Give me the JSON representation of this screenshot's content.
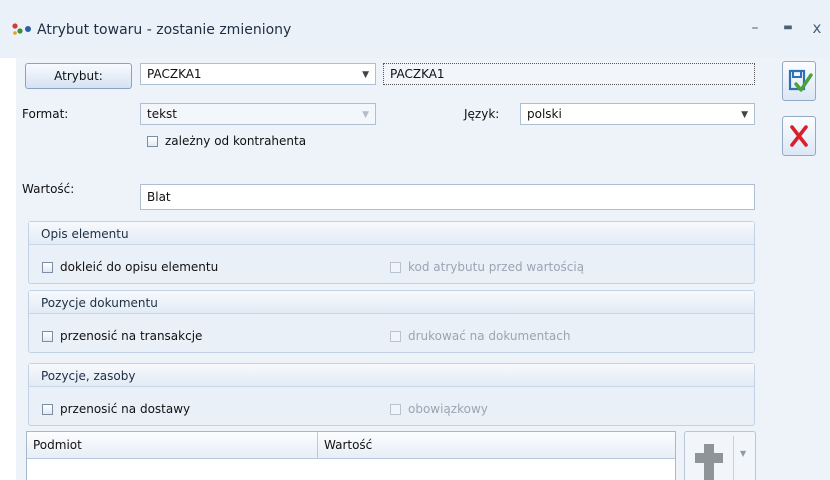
{
  "window": {
    "title": "Atrybut towaru - zostanie zmieniony",
    "controls": {
      "minimize": "–",
      "maximize": "▬",
      "close": "x"
    }
  },
  "form": {
    "attribute_button": "Atrybut:",
    "attribute_value": "PACZKA1",
    "attribute_code": "PACZKA1",
    "format_label": "Format:",
    "format_value": "tekst",
    "language_label": "Język:",
    "language_value": "polski",
    "dependent_checkbox": "zależny od kontrahenta",
    "value_label": "Wartość:",
    "value_value": "Blat"
  },
  "groups": [
    {
      "title": "Opis elementu",
      "left_checkbox": "dokleić do opisu elementu",
      "right_checkbox": "kod atrybutu przed wartością"
    },
    {
      "title": "Pozycje dokumentu",
      "left_checkbox": "przenosić na transakcje",
      "right_checkbox": "drukować na dokumentach"
    },
    {
      "title": "Pozycje, zasoby",
      "left_checkbox": "przenosić na dostawy",
      "right_checkbox": "obowiązkowy"
    }
  ],
  "grid": {
    "columns": [
      "Podmiot",
      "Wartość"
    ]
  },
  "colors": {
    "accent": "#2f6fb6",
    "cancel": "#d9202a",
    "save_check": "#4aa23a"
  }
}
